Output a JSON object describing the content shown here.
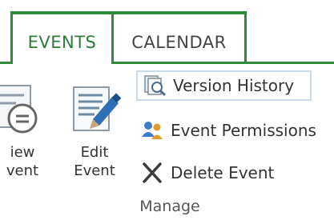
{
  "tabs": {
    "events": "EVENTS",
    "calendar": "CALENDAR"
  },
  "manage": {
    "view_label_line1": "iew",
    "view_label_line2": "vent",
    "edit_label_line1": "Edit",
    "edit_label_line2": "Event",
    "version_history": "Version History",
    "event_permissions": "Event Permissions",
    "delete_event": "Delete Event",
    "group_label": "Manage"
  },
  "icons": {
    "view": "view-event-icon",
    "edit": "edit-event-icon",
    "version": "version-history-icon",
    "permissions": "permissions-icon",
    "delete": "delete-icon"
  },
  "colors": {
    "accent_green": "#2f8a3a",
    "tab_text_active": "#2d7d3a",
    "highlight_border": "#c9d9e8"
  },
  "selected_tab": "EVENTS"
}
